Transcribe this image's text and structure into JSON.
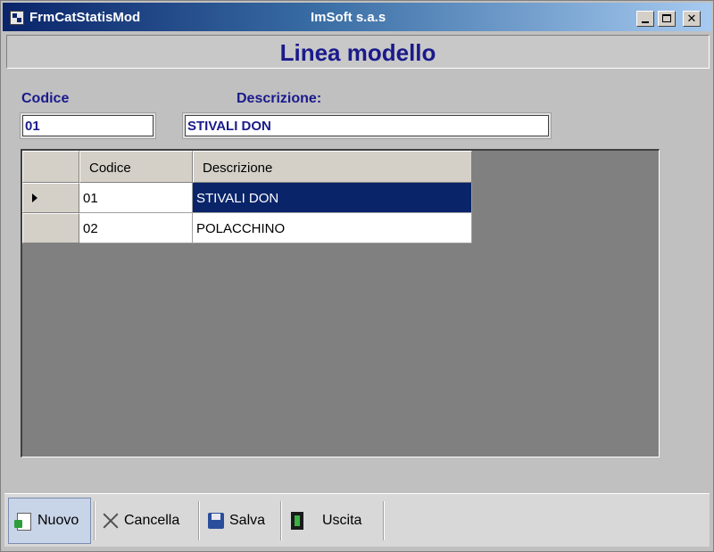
{
  "window": {
    "title": "FrmCatStatisMod",
    "center_title": "ImSoft s.a.s",
    "close_glyph": "✕"
  },
  "header": {
    "title": "Linea modello"
  },
  "form": {
    "codice_label": "Codice",
    "codice_value": "01",
    "descrizione_label": "Descrizione:",
    "descrizione_value": "STIVALI DON"
  },
  "grid": {
    "columns": [
      "Codice",
      "Descrizione"
    ],
    "rows": [
      {
        "codice": "01",
        "descrizione": "STIVALI DON",
        "selected": true
      },
      {
        "codice": "02",
        "descrizione": "POLACCHINO",
        "selected": false
      }
    ]
  },
  "toolbar": {
    "nuovo": "Nuovo",
    "cancella": "Cancella",
    "salva": "Salva",
    "uscita": "Uscita"
  },
  "colors": {
    "titlebar_start": "#0A246A",
    "header_text": "#1A1A8C",
    "selection": "#0A246A",
    "grid_background": "#808080"
  }
}
